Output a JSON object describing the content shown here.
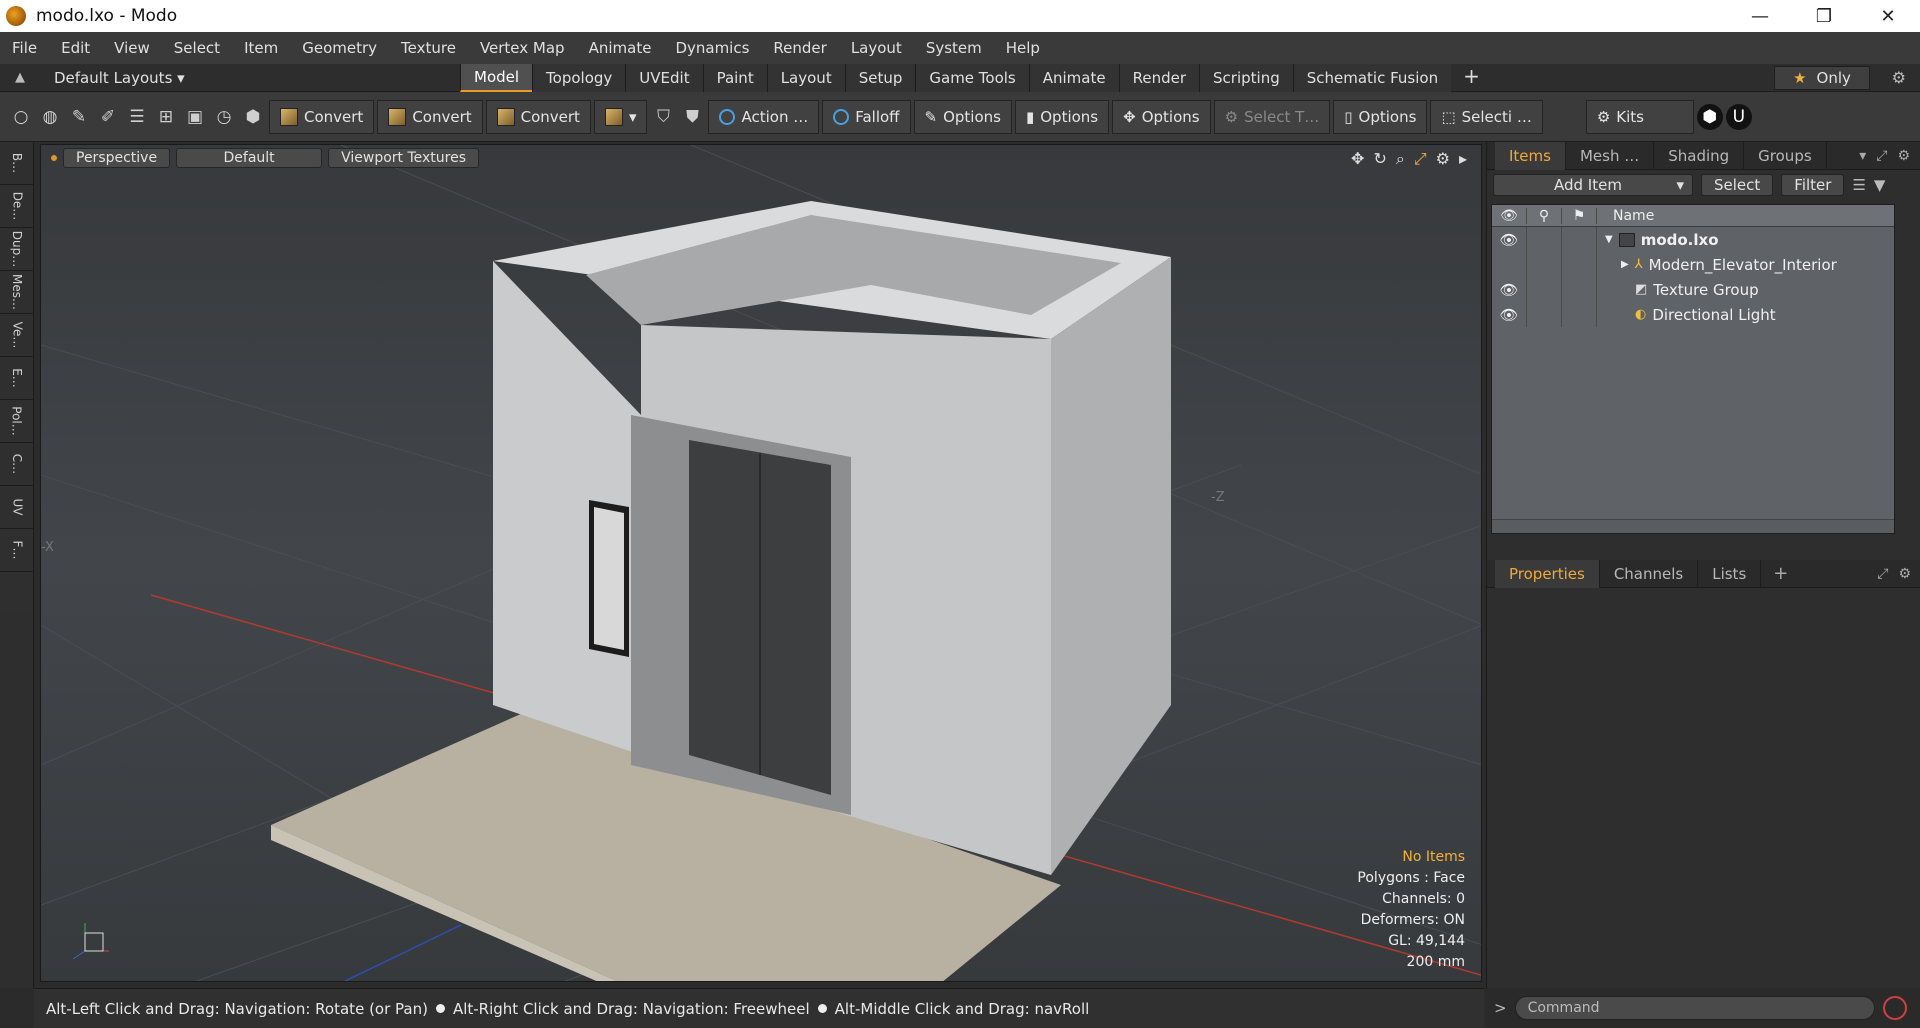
{
  "window": {
    "title": "modo.lxo - Modo",
    "min": "—",
    "max": "❐",
    "close": "✕"
  },
  "menu": [
    "File",
    "Edit",
    "View",
    "Select",
    "Item",
    "Geometry",
    "Texture",
    "Vertex Map",
    "Animate",
    "Dynamics",
    "Render",
    "Layout",
    "System",
    "Help"
  ],
  "layout_dropdown": "Default Layouts ▾",
  "tabs": [
    "Model",
    "Topology",
    "UVEdit",
    "Paint",
    "Layout",
    "Setup",
    "Game Tools",
    "Animate",
    "Render",
    "Scripting",
    "Schematic Fusion"
  ],
  "active_tab": "Model",
  "only_label": "Only",
  "toolbar": {
    "convert1": "Convert",
    "convert2": "Convert",
    "convert3": "Convert",
    "action": "Action …",
    "falloff": "Falloff",
    "options1": "Options",
    "options2": "Options",
    "options3": "Options",
    "select_t": "Select T…",
    "options4": "Options",
    "selecti": "Selecti …",
    "kits": "Kits"
  },
  "left_tabs": [
    "B…",
    "De…",
    "Dup…",
    "Mes…",
    "Ve…",
    "E…",
    "Pol…",
    "C…",
    "UV",
    "F…"
  ],
  "viewport": {
    "perspective": "Perspective",
    "default": "Default",
    "textures": "Viewport Textures",
    "info": {
      "no_items": "No Items",
      "polygons": "Polygons : Face",
      "channels": "Channels: 0",
      "deformers": "Deformers: ON",
      "gl": "GL: 49,144",
      "size": "200 mm"
    },
    "axis_z": "-Z",
    "axis_x": "-X"
  },
  "status": {
    "part1": "Alt-Left Click and Drag: Navigation: Rotate (or Pan)",
    "part2": "Alt-Right Click and Drag: Navigation: Freewheel",
    "part3": "Alt-Middle Click and Drag: navRoll"
  },
  "items_panel": {
    "tabs": [
      "Items",
      "Mesh …",
      "Shading",
      "Groups"
    ],
    "add_item": "Add Item",
    "select": "Select",
    "filter": "Filter",
    "name_col": "Name",
    "rows": [
      {
        "name": "modo.lxo",
        "visible": true
      },
      {
        "name": "Modern_Elevator_Interior",
        "visible": false
      },
      {
        "name": "Texture Group",
        "visible": true
      },
      {
        "name": "Directional Light",
        "visible": true
      }
    ]
  },
  "props_panel": {
    "tabs": [
      "Properties",
      "Channels",
      "Lists"
    ]
  },
  "command": {
    "placeholder": "Command"
  },
  "colors": {
    "accent": "#f0a93a",
    "viewport_bg": "#3e4145"
  }
}
